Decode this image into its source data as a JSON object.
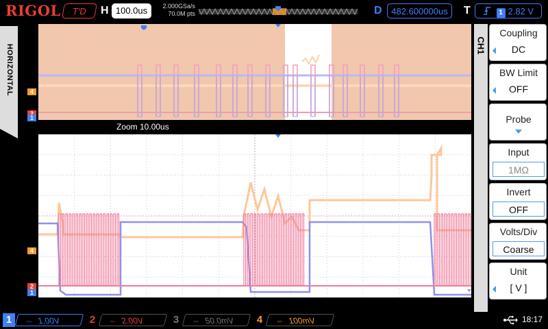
{
  "brand": "RIGOL",
  "header": {
    "status": "T'D",
    "timebase_label": "H",
    "timebase": "100.0us",
    "sample_rate": "2.000GSa/s",
    "mem_depth": "70.0M pts",
    "delay_label": "D",
    "delay": "482.600000us",
    "trigger_label": "T",
    "trigger_source": "1",
    "trigger_level": "2.82 V"
  },
  "side_tab": "HORIZONTAL",
  "zoom_label": "Zoom  10.00us",
  "menu": {
    "channel": "CH1",
    "items": [
      {
        "title": "Coupling",
        "value": "DC"
      },
      {
        "title": "BW Limit",
        "value": "OFF"
      },
      {
        "title": "Probe",
        "value": ""
      },
      {
        "title": "Input",
        "value": "1MΩ"
      },
      {
        "title": "Invert",
        "value": "OFF"
      },
      {
        "title": "Volts/Div",
        "value": "Coarse"
      },
      {
        "title": "Unit",
        "value": "[ V ]"
      }
    ]
  },
  "channels": [
    {
      "num": "1",
      "scale": "1.00V",
      "color": "#3f7ff7"
    },
    {
      "num": "2",
      "scale": "2.00V",
      "color": "#e8402c"
    },
    {
      "num": "3",
      "scale": "50.0mV",
      "color": "#777777"
    },
    {
      "num": "4",
      "scale": "100mV",
      "color": "#f59c2a"
    }
  ],
  "trace_markers": {
    "ch4": "4",
    "ch2": "2",
    "ch1": "1",
    "trigger": "T"
  },
  "clock": "18:17",
  "icons": {
    "usb": "usb-icon",
    "trigger_edge": "rising-edge-icon"
  }
}
